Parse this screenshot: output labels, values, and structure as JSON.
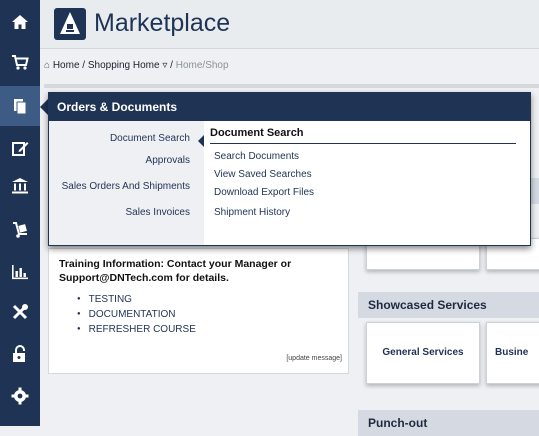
{
  "header": {
    "title": "Marketplace"
  },
  "breadcrumb": {
    "home": "Home",
    "sep1": "/",
    "shopping_home": "Shopping Home",
    "sep2": "/",
    "current": "Home/Shop"
  },
  "sidebar": {
    "items": [
      {
        "icon": "home-icon"
      },
      {
        "icon": "cart-icon"
      },
      {
        "icon": "documents-icon"
      },
      {
        "icon": "edit-icon"
      },
      {
        "icon": "bank-icon"
      },
      {
        "icon": "dolly-icon"
      },
      {
        "icon": "bar-chart-icon"
      },
      {
        "icon": "tools-icon"
      },
      {
        "icon": "lock-icon"
      },
      {
        "icon": "gear-icon"
      }
    ]
  },
  "popup": {
    "title": "Orders & Documents",
    "categories": [
      "Document Search",
      "Approvals",
      "Sales Orders And Shipments",
      "Sales Invoices"
    ],
    "submenu_title": "Document Search",
    "submenu_links": [
      "Search Documents",
      "View Saved Searches",
      "Download Export Files",
      "Shipment History"
    ]
  },
  "training": {
    "text": "Training Information: Contact your Manager or Support@DNTech.com for details.",
    "links": [
      "TESTING",
      "DOCUMENTATION",
      "REFRESHER COURSE"
    ],
    "update_label": "[update message]"
  },
  "showcased": {
    "title": "Showcased Services",
    "cards": [
      "General Services",
      "Busine"
    ]
  },
  "punchout": {
    "title": "Punch-out"
  },
  "colors": {
    "navy": "#1f3354",
    "sidebar_active": "#3e5b86",
    "page_bg": "#eef0f3"
  }
}
